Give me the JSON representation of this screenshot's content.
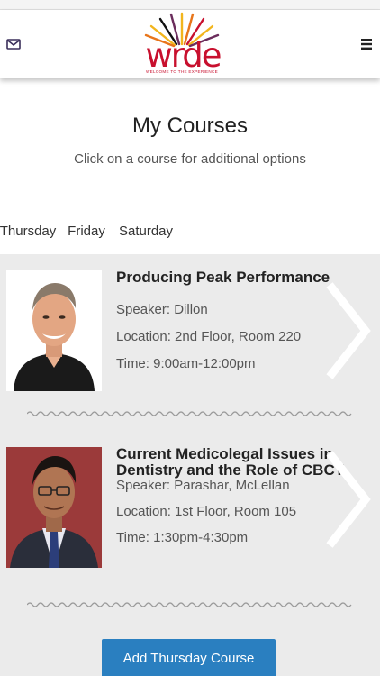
{
  "header": {
    "logo_text": "wrde",
    "logo_tagline": "WELCOME TO THE EXPERIENCE"
  },
  "page": {
    "title": "My Courses",
    "subtitle": "Click on a course for additional options"
  },
  "tabs": [
    {
      "label": "Thursday",
      "active": true
    },
    {
      "label": "Friday",
      "active": false
    },
    {
      "label": "Saturday",
      "active": false
    }
  ],
  "courses": [
    {
      "title": "Producing Peak Performance",
      "speaker": "Speaker: Dillon",
      "location": "Location: 2nd Floor, Room 220",
      "time": "Time: 9:00am-12:00pm"
    },
    {
      "title": "Current Medicolegal Issues in Dentistry and the Role of CBCT",
      "speaker": "Speaker: Parashar, McLellan",
      "location": "Location: 1st Floor, Room 105",
      "time": "Time: 1:30pm-4:30pm"
    }
  ],
  "add_button_label": "Add Thursday Course",
  "colors": {
    "brand_red": "#c8102e",
    "button_blue": "#2a7fc0",
    "list_bg": "#ebebeb"
  },
  "icons": {
    "mail": "envelope-icon",
    "menu": "hamburger-menu-icon",
    "chevron": "chevron-right-icon"
  }
}
